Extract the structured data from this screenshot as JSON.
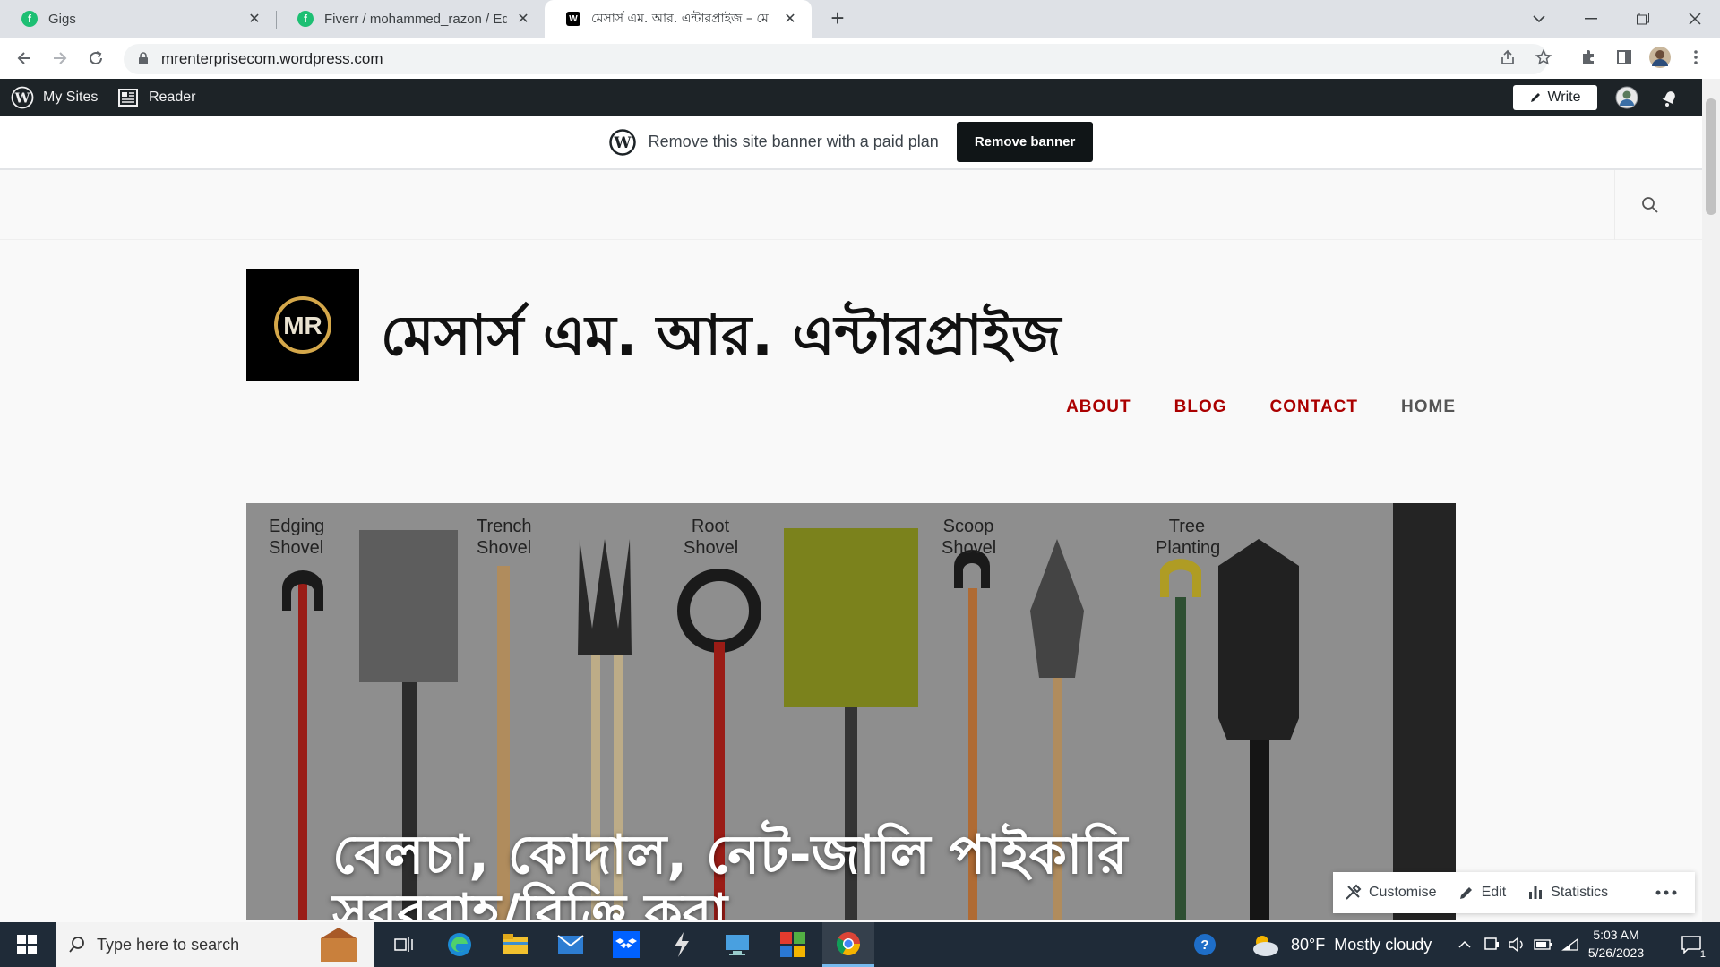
{
  "browser": {
    "tabs": [
      {
        "label": "Gigs",
        "favicon": "fiverr-icon",
        "favicon_color": "#1dbf73"
      },
      {
        "label": "Fiverr / mohammed_razon / Edit",
        "favicon": "fiverr-icon",
        "favicon_color": "#1dbf73"
      },
      {
        "label": "মেসার্স এম. আর. এন্টারপ্রাইজ – মে",
        "favicon": "wordpress-icon",
        "favicon_color": "#000000",
        "active": true
      }
    ],
    "url": "mrenterprisecom.wordpress.com"
  },
  "wp_admin_bar": {
    "my_sites": "My Sites",
    "reader": "Reader",
    "write": "Write"
  },
  "banner": {
    "text": "Remove this site banner with a paid plan",
    "button": "Remove banner"
  },
  "site": {
    "title": "মেসার্স এম. আর. এন্টারপ্রাইজ",
    "logo_text": "MR",
    "nav": [
      "ABOUT",
      "BLOG",
      "CONTACT",
      "HOME"
    ],
    "hero": {
      "labels": [
        "Edging Shovel",
        "Trench Shovel",
        "Root Shovel",
        "Scoop Shovel",
        "Tree Planting"
      ],
      "title": "বেলচা, কোদাল, নেট-জালি পাইকারি সরবরাহ/বিক্রি করা"
    }
  },
  "floating_toolbar": {
    "customise": "Customise",
    "edit": "Edit",
    "statistics": "Statistics"
  },
  "taskbar": {
    "search_placeholder": "Type here to search",
    "weather_temp": "80°F",
    "weather_desc": "Mostly cloudy",
    "time": "5:03 AM",
    "date": "5/26/2023",
    "notification_count": "1"
  },
  "colors": {
    "nav_accent": "#aa0000",
    "wp_bar": "#1d2327",
    "taskbar": "#1f2b38"
  }
}
